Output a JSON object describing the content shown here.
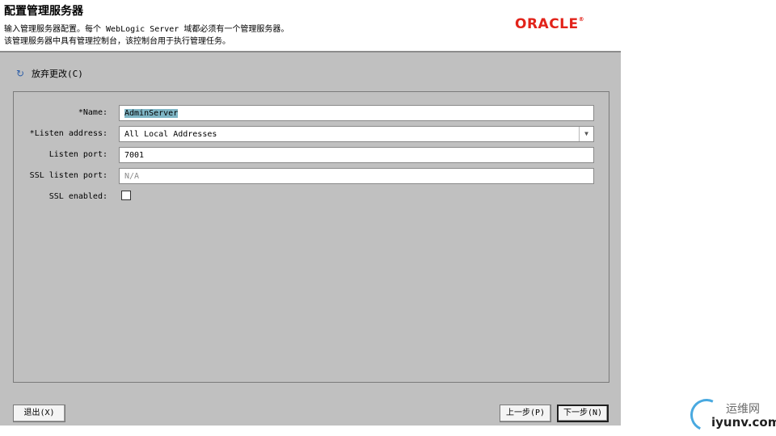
{
  "header": {
    "title": "配置管理服务器",
    "description_line1": "输入管理服务器配置。每个 WebLogic Server 域都必须有一个管理服务器。",
    "description_line2": "该管理服务器中具有管理控制台，该控制台用于执行管理任务。",
    "logo": "ORACLE",
    "logo_mark": "®"
  },
  "toolbar": {
    "undo_label": "放弃更改(C)",
    "undo_icon": "undo-icon"
  },
  "form": {
    "name_label": "*Name:",
    "name_value": "AdminServer",
    "listen_address_label": "*Listen address:",
    "listen_address_value": "All Local Addresses",
    "listen_port_label": "Listen port:",
    "listen_port_value": "7001",
    "ssl_port_label": "SSL listen port:",
    "ssl_port_placeholder": "N/A",
    "ssl_enabled_label": "SSL enabled:",
    "ssl_enabled": false
  },
  "buttons": {
    "exit": "退出(X)",
    "prev": "上一步(P)",
    "next": "下一步(N)"
  },
  "watermark": {
    "cn": "运维网",
    "en": "iyunv.com"
  },
  "colors": {
    "oracle_red": "#e2231a",
    "dialog_gray": "#c0c0c0",
    "selection": "#7fb6c6",
    "watermark_blue": "#49a9e0"
  }
}
